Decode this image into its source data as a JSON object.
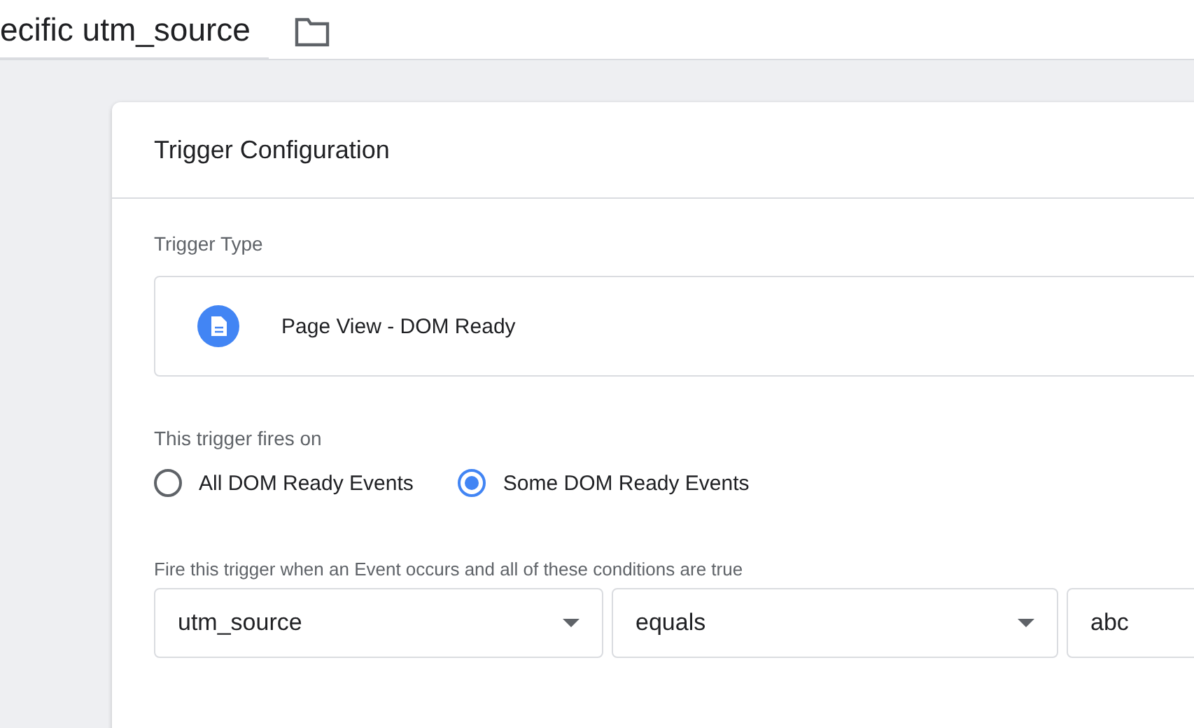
{
  "header": {
    "title": "ecific utm_source"
  },
  "card": {
    "title": "Trigger Configuration",
    "trigger_type": {
      "label": "Trigger Type",
      "name": "Page View - DOM Ready"
    },
    "fires_on": {
      "label": "This trigger fires on",
      "options": [
        {
          "label": "All DOM Ready Events",
          "selected": false
        },
        {
          "label": "Some DOM Ready Events",
          "selected": true
        }
      ]
    },
    "conditions": {
      "label": "Fire this trigger when an Event occurs and all of these conditions are true",
      "row": [
        {
          "kind": "select",
          "value": "utm_source"
        },
        {
          "kind": "select",
          "value": "equals"
        },
        {
          "kind": "input",
          "value": "abc"
        }
      ]
    }
  }
}
